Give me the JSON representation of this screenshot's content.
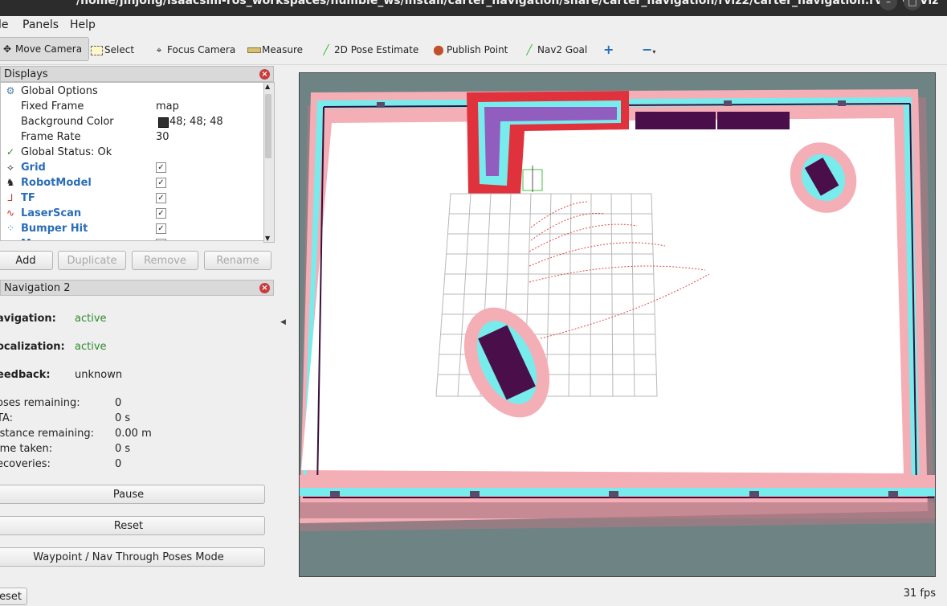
{
  "window": {
    "title": "/home/jinjong/isaacsim-ros_workspaces/humble_ws/install/carter_navigation/share/carter_navigation/rviz2/carter_navigation.rviz* - RViz"
  },
  "menu": {
    "file": "le",
    "panels": "Panels",
    "help": "Help"
  },
  "toolbar": {
    "move_camera": "Move Camera",
    "select": "Select",
    "focus_camera": "Focus Camera",
    "measure": "Measure",
    "pose_estimate": "2D Pose Estimate",
    "publish_point": "Publish Point",
    "nav2_goal": "Nav2 Goal",
    "plus": "+",
    "minus": "−"
  },
  "displays": {
    "title": "Displays",
    "rows": [
      {
        "name": "Global Options",
        "value": ""
      },
      {
        "name": "Fixed Frame",
        "value": "map"
      },
      {
        "name": "Background Color",
        "value": "48; 48; 48"
      },
      {
        "name": "Frame Rate",
        "value": "30"
      },
      {
        "name": "Global Status: Ok",
        "value": ""
      },
      {
        "name": "Grid",
        "value": "✓"
      },
      {
        "name": "RobotModel",
        "value": "✓"
      },
      {
        "name": "TF",
        "value": "✓"
      },
      {
        "name": "LaserScan",
        "value": "✓"
      },
      {
        "name": "Bumper Hit",
        "value": "✓"
      },
      {
        "name": "M",
        "value": "✓"
      }
    ],
    "background_swatch": "#303030",
    "buttons": {
      "add": "Add",
      "duplicate": "Duplicate",
      "remove": "Remove",
      "rename": "Rename"
    }
  },
  "navigation": {
    "title": "Navigation 2",
    "navigation_label": "avigation:",
    "navigation_value": "active",
    "localization_label": "ocalization:",
    "localization_value": "active",
    "feedback_label": "eedback:",
    "feedback_value": "unknown",
    "poses_label": "oses remaining:",
    "poses_value": "0",
    "eta_label": "TA:",
    "eta_value": "0 s",
    "distance_label": "istance remaining:",
    "distance_value": "0.00 m",
    "time_label": "ime taken:",
    "time_value": "0 s",
    "recoveries_label": "ecoveries:",
    "recoveries_value": "0",
    "pause": "Pause",
    "reset": "Reset",
    "mode": "Waypoint / Nav Through Poses Mode"
  },
  "status": {
    "reset": "eset",
    "fps": "31 fps"
  },
  "colors": {
    "costmap_pink": "#f4aeb6",
    "costmap_cyan": "#78ecec",
    "obstacle": "#4a0f4a",
    "lethal_red": "#e0323c"
  }
}
